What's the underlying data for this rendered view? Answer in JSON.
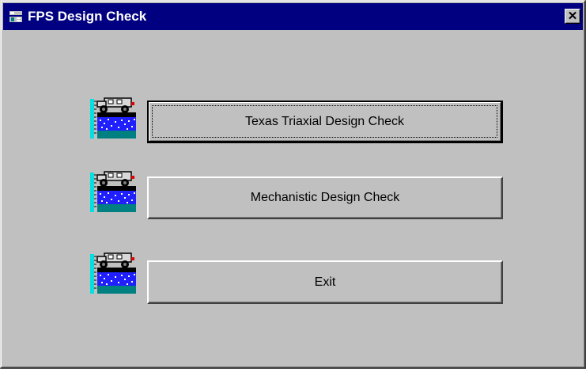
{
  "window": {
    "title": "FPS Design Check",
    "close_glyph": "✕",
    "title_icon": "app-icon",
    "titlebar_color": "#000080",
    "face_color": "#c0c0c0"
  },
  "actions": [
    {
      "label": "Texas  Triaxial Design Check",
      "icon": "pavement-truck-icon",
      "is_default": true
    },
    {
      "label": "Mechanistic Design  Check",
      "icon": "pavement-truck-icon",
      "is_default": false
    },
    {
      "label": "Exit",
      "icon": "pavement-truck-icon",
      "is_default": false
    }
  ]
}
